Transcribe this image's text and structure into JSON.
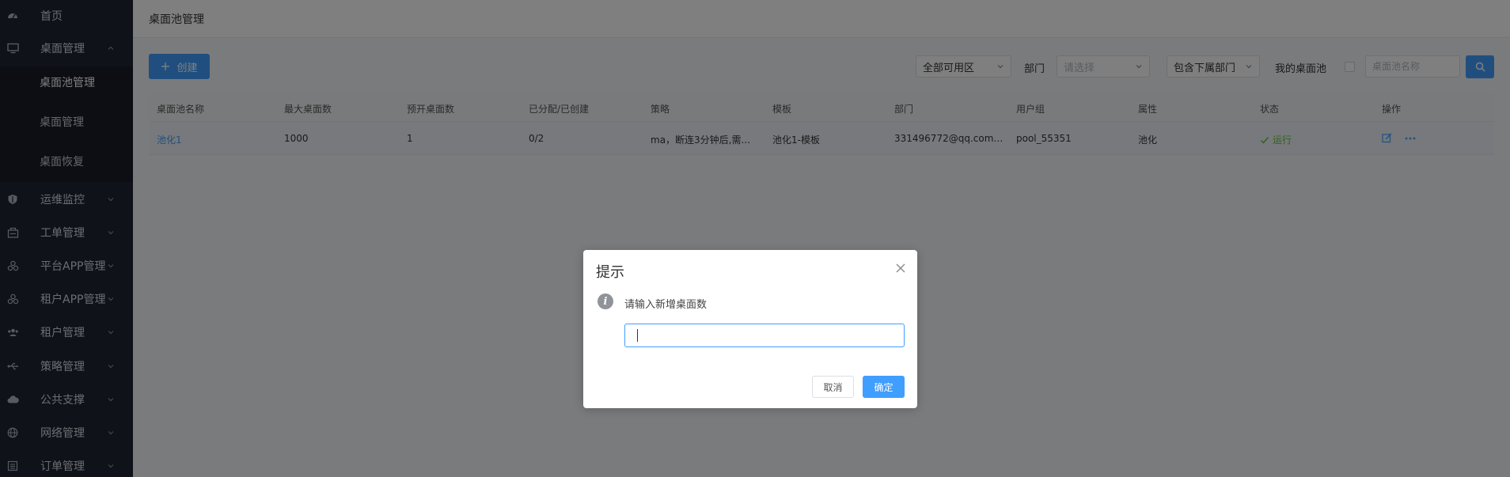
{
  "sidebar": {
    "items": [
      {
        "label": "首页",
        "icon": "dashboard-icon"
      },
      {
        "label": "桌面管理",
        "icon": "monitor-icon",
        "expanded": true
      },
      {
        "label": "运维监控",
        "icon": "shield-icon"
      },
      {
        "label": "工单管理",
        "icon": "ticket-icon"
      },
      {
        "label": "平台APP管理",
        "icon": "apps-icon"
      },
      {
        "label": "租户APP管理",
        "icon": "apps-icon"
      },
      {
        "label": "租户管理",
        "icon": "users-icon"
      },
      {
        "label": "策略管理",
        "icon": "usb-icon"
      },
      {
        "label": "公共支撑",
        "icon": "cloud-icon"
      },
      {
        "label": "网络管理",
        "icon": "globe-icon"
      },
      {
        "label": "订单管理",
        "icon": "list-icon"
      }
    ],
    "subitems": [
      {
        "label": "桌面池管理",
        "active": true
      },
      {
        "label": "桌面管理"
      },
      {
        "label": "桌面恢复"
      }
    ]
  },
  "header": {
    "title": "桌面池管理"
  },
  "toolbar": {
    "create_label": "创建",
    "zone_select": "全部可用区",
    "dept_label": "部门",
    "dept_placeholder": "请选择",
    "sub_dept_select": "包含下属部门",
    "my_pool_label": "我的桌面池",
    "search_placeholder": "桌面池名称"
  },
  "table": {
    "columns": [
      "桌面池名称",
      "最大桌面数",
      "预开桌面数",
      "已分配/已创建",
      "策略",
      "模板",
      "部门",
      "用户组",
      "属性",
      "状态",
      "操作"
    ],
    "rows": [
      {
        "name": "池化1",
        "max_desktops": "1000",
        "prestart": "1",
        "allocated": "0/2",
        "policy": "ma，断连3分钟后,需...",
        "template": "池化1-模板",
        "department": "331496772@qq.com#...",
        "user_group": "pool_55351",
        "attribute": "池化",
        "status": "运行"
      }
    ]
  },
  "dialog": {
    "title": "提示",
    "message": "请输入新增桌面数",
    "input_value": "",
    "cancel_label": "取消",
    "confirm_label": "确定"
  },
  "colors": {
    "primary": "#409eff",
    "sidebar_bg": "#1f2433",
    "success": "#67c23a"
  }
}
